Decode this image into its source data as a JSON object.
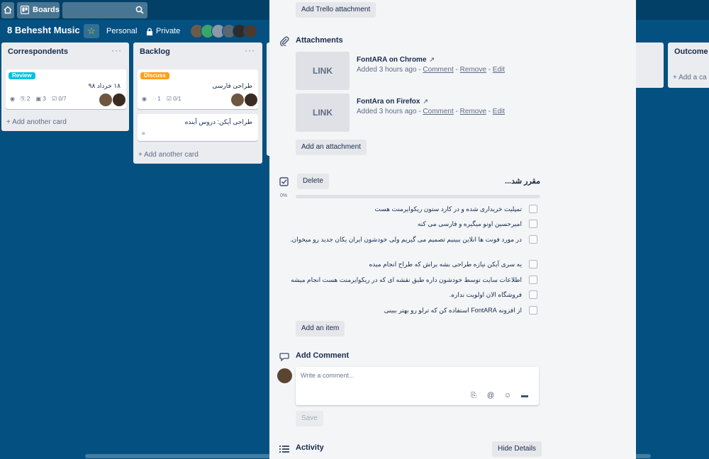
{
  "topbar": {
    "boards_label": "Boards"
  },
  "board": {
    "title": "8 Behesht Music",
    "personal_label": "Personal",
    "private_label": "Private"
  },
  "lists": [
    {
      "title": "Correspondents",
      "cards": [
        {
          "label": "Review",
          "label_color": "#00c2e0",
          "title": "۱۸ خرداد ۹۸",
          "badges": {
            "attachments": "2",
            "images": "3",
            "checklist": "0/7"
          }
        }
      ],
      "add_label": "+ Add another card"
    },
    {
      "title": "Backlog",
      "cards": [
        {
          "label": "Discuss",
          "label_color": "#ff9f1a",
          "title": "طراحی فارسی",
          "badges": {
            "comments": "1",
            "checklist": "0/1"
          }
        },
        {
          "title": "طراحی آیکن: دروس آینده"
        }
      ],
      "add_label": "+ Add another card"
    },
    {
      "title": "Outcome",
      "add_label": "+ Add a ca"
    }
  ],
  "modal": {
    "add_trello_attachment": "Add Trello attachment",
    "attachments_title": "Attachments",
    "attachments": [
      {
        "thumb": "LINK",
        "name": "FontARA on Chrome",
        "added": "Added 3 hours ago -",
        "comment": "Comment",
        "remove": "Remove",
        "edit": "Edit"
      },
      {
        "thumb": "LINK",
        "name": "FontAra on Firefox",
        "added": "Added 3 hours ago -",
        "comment": "Comment",
        "remove": "Remove",
        "edit": "Edit"
      }
    ],
    "add_attachment": "Add an attachment",
    "checklist": {
      "title": "مقرر شد...",
      "delete_label": "Delete",
      "percent_label": "0%",
      "progress": 0,
      "items": [
        "تمپلیت خریداری شده و در کارد ستون ریکوایرمنت هست",
        "امیرحسین اونو میگیره و فارسی می کنه",
        "در مورد فونت ها انلاین ببینیم تصمیم می گیریم ولی خودشون ایران یکان جدید رو میخوان.",
        "یه سری آیکن نیازه طراحی بشه براش که طراح انجام میده",
        "اطلاعات سایت توسط خودشون داره طبق نقشه ای که در ریکوایرمنت هست انجام میشه",
        "فروشگاه الان اولویت نداره.",
        "از افزونه FontARA استفاده کن که ترلو رو بهتر ببینی"
      ],
      "add_item": "Add an item"
    },
    "comment": {
      "title": "Add Comment",
      "placeholder": "Write a comment...",
      "save_label": "Save"
    },
    "activity": {
      "title": "Activity",
      "hide_details": "Hide Details"
    }
  }
}
